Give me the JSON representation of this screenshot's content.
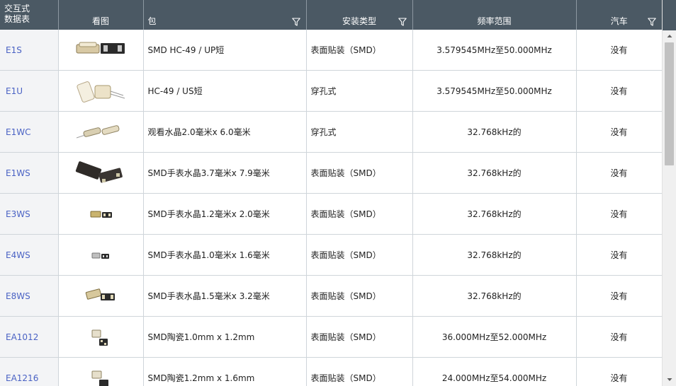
{
  "columns": {
    "interactive_line1": "交互式",
    "interactive_line2": "数据表",
    "view": "看图",
    "package": "包",
    "mount": "安装类型",
    "freq": "频率范围",
    "auto": "汽车"
  },
  "icons": {
    "filter": "filter-icon",
    "thumbnail": "crystal-product-image"
  },
  "rows": [
    {
      "part": "E1S",
      "package": "SMD HC-49 / UP短",
      "mount": "表面贴装（SMD）",
      "freq": "3.579545MHz至50.000MHz",
      "auto": "没有"
    },
    {
      "part": "E1U",
      "package": "HC-49 / US短",
      "mount": "穿孔式",
      "freq": "3.579545MHz至50.000MHz",
      "auto": "没有"
    },
    {
      "part": "E1WC",
      "package": "观看水晶2.0毫米x 6.0毫米",
      "mount": "穿孔式",
      "freq": "32.768kHz的",
      "auto": "没有"
    },
    {
      "part": "E1WS",
      "package": "SMD手表水晶3.7毫米x 7.9毫米",
      "mount": "表面贴装（SMD）",
      "freq": "32.768kHz的",
      "auto": "没有"
    },
    {
      "part": "E3WS",
      "package": "SMD手表水晶1.2毫米x 2.0毫米",
      "mount": "表面贴装（SMD）",
      "freq": "32.768kHz的",
      "auto": "没有"
    },
    {
      "part": "E4WS",
      "package": "SMD手表水晶1.0毫米x 1.6毫米",
      "mount": "表面贴装（SMD）",
      "freq": "32.768kHz的",
      "auto": "没有"
    },
    {
      "part": "E8WS",
      "package": "SMD手表水晶1.5毫米x 3.2毫米",
      "mount": "表面贴装（SMD）",
      "freq": "32.768kHz的",
      "auto": "没有"
    },
    {
      "part": "EA1012",
      "package": "SMD陶瓷1.0mm x 1.2mm",
      "mount": "表面贴装（SMD）",
      "freq": "36.000MHz至52.000MHz",
      "auto": "没有"
    },
    {
      "part": "EA1216",
      "package": "SMD陶瓷1.2mm x 1.6mm",
      "mount": "表面贴装（SMD）",
      "freq": "24.000MHz至54.000MHz",
      "auto": "没有"
    }
  ]
}
